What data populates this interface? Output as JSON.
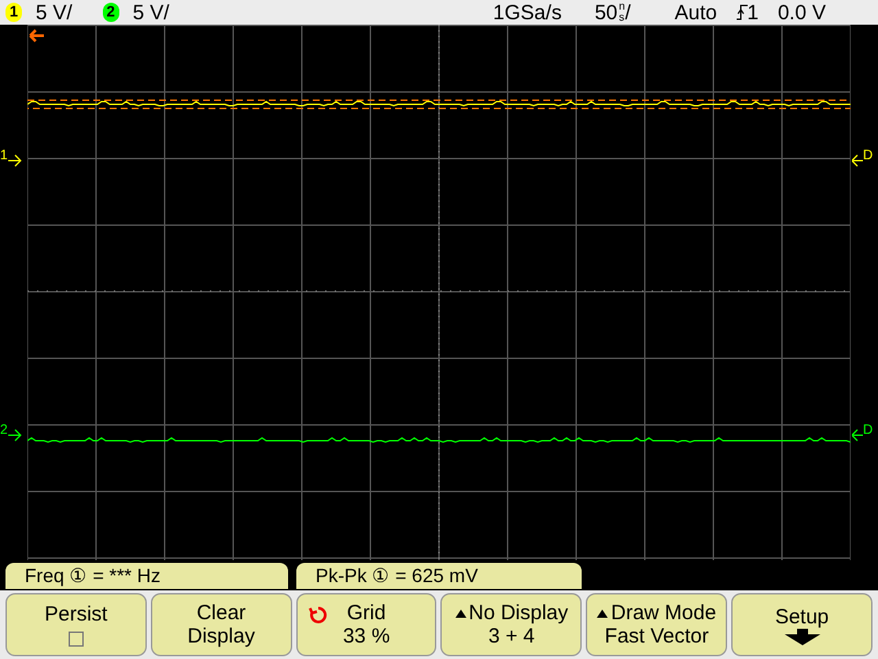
{
  "status_bar": {
    "channels": [
      {
        "number": "1",
        "scale": "5 V/",
        "color": "#ffff00"
      },
      {
        "number": "2",
        "scale": "5 V/",
        "color": "#00ff00"
      }
    ],
    "sample_rate": "1GSa/s",
    "timebase": {
      "value": "50",
      "prefix": "n",
      "unit": "s",
      "slash": "/"
    },
    "trigger_mode": "Auto",
    "trigger_source": "1",
    "trigger_level": "0.0 V"
  },
  "graticule": {
    "traces": [
      {
        "label": "1",
        "coupling": "D",
        "color": "#ffff00"
      },
      {
        "label": "2",
        "coupling": "D",
        "color": "#00ff00"
      }
    ]
  },
  "measurements": [
    "Freq ① = *** Hz",
    "Pk-Pk ① = 625 mV"
  ],
  "softkeys": [
    {
      "kind": "checkbox",
      "label": "Persist",
      "checked": false
    },
    {
      "kind": "text",
      "lines": [
        "Clear",
        "Display"
      ]
    },
    {
      "kind": "knob",
      "label": "Grid",
      "value": "33 %"
    },
    {
      "kind": "toggle",
      "label": "No Display",
      "value": "3 + 4"
    },
    {
      "kind": "toggle",
      "label": "Draw Mode",
      "value": "Fast Vector"
    },
    {
      "kind": "menu",
      "label": "Setup"
    }
  ]
}
